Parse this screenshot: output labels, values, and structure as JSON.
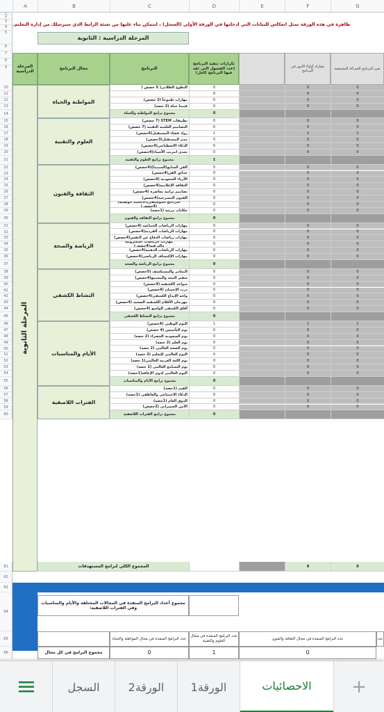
{
  "columns": [
    "A",
    "B",
    "C",
    "D",
    "E",
    "F",
    "G"
  ],
  "notice": "ظاهرة في هذه الورقة تمثل انعكاس للبيانات التي ادخلتها في الورقة الأولى (السجل) ، لتتمكن بناء عليها من تعبئة الرابط الذي سيرسلك من إدارة التعليم.",
  "stage_label": "المرحلة الدراسية : الثانوية",
  "headers": {
    "stage": "المرحلة الدراسية",
    "domain": "مجال البرنامج",
    "program": "البرنامج",
    "count": "تكرارات تنفيذ البرنامج (عدد الفصول التي نُفذ فيها البرنامج كامل)",
    "parents": "يشارك أولياء الأمور في البرنامج",
    "community": "يعزز البرنامج الشراكة المجتمعية"
  },
  "stage_vertical": "المرحلة الثانوية",
  "sections": [
    {
      "name": "المواطنة والحياة",
      "rows": [
        {
          "p": "التطوع الطلابي( 5 حصص )",
          "v": "0"
        },
        {
          "p": "",
          "v": "0"
        },
        {
          "p": "مهارات طموحاً (2 حصص)",
          "v": "0"
        },
        {
          "p": "قيمنا حياة (2 حصة)",
          "v": "0"
        }
      ],
      "total": "مجموع برامج المواطنة والحياة",
      "tv": "0"
    },
    {
      "name": "العلوم والتقنية",
      "rows": [
        {
          "p": "تطبيقات STEM (7 حصص)",
          "v": "0"
        },
        {
          "p": "التصاميم العلمية التقنية (7 حصص)",
          "v": "0"
        },
        {
          "p": "رواد فضاء المستقبل(6حصص)",
          "v": "1"
        },
        {
          "p": "مدن المستقبل(3حصص)",
          "v": "0"
        },
        {
          "p": "الذكاء الاصطناعي(4حصص)",
          "v": "0"
        },
        {
          "p": "تحدي انترنت الأشياء(4حصص)",
          "v": "0"
        }
      ],
      "total": "مجموع برامج العلوم والتقنية",
      "tv": "1"
    },
    {
      "name": "الثقافة والفنون",
      "rows": [
        {
          "p": "الفن السابع(السينما)(4حصص)",
          "v": "0"
        },
        {
          "p": "حدائق الفن(4حصص)",
          "v": "0"
        },
        {
          "p": "الأزياء السعودية (4حصص)",
          "v": "0"
        },
        {
          "p": "الثقافة الإعلامية(4حصص)",
          "v": "0"
        },
        {
          "p": "تصاميم تراثية معاصرة (4حصص)",
          "v": "0"
        },
        {
          "p": "الفنون المسرحية(4حصص)",
          "v": "0"
        },
        {
          "p": "البرنامج الموسيقي(الأناشيد الوطنية)(4حصص)",
          "v": "0"
        },
        {
          "p": "حكايات مرئية (1حصة)",
          "v": "0"
        }
      ],
      "total": "مجموع برامج الثقافة والفنون",
      "tv": "0"
    },
    {
      "name": "الرياضة والصحة",
      "rows": [
        {
          "p": "مهارات الرياضات الجماعية (4حصص)",
          "v": "0"
        },
        {
          "p": "مهارات الرياضات الفردية(4حصص)",
          "v": "0"
        },
        {
          "p": "مهارات رياضات الدفاع عن النفس(4حصص)",
          "v": "0"
        },
        {
          "p": "مهارات الرياضات الإلكترونية والترفيه(4حصص)",
          "v": "0"
        },
        {
          "p": "مهارات الرياضات الذهنية(4حصص)",
          "v": "0"
        },
        {
          "p": "مهارات الإكتشاف الرياضي(4حصص)",
          "v": "0"
        }
      ],
      "total": "مجموع برامج الرياضة والصحة",
      "tv": "0"
    },
    {
      "name": "النشاط الكشفي",
      "rows": [
        {
          "p": "المغامر والمستكشف (5حصص)",
          "v": "0"
        },
        {
          "p": "سفير البيئة والمجتمع(4حصص)",
          "v": "0"
        },
        {
          "p": "سواعد الكشفية (4حصص)",
          "v": "0"
        },
        {
          "p": "درب الإحسان (4حصص)",
          "v": "0"
        },
        {
          "p": "واحة الإبداع الكشفي(4حصص)",
          "v": "0"
        },
        {
          "p": "مهرجان الأفلام الكشفية الصحية (4حصص)",
          "v": "0"
        },
        {
          "p": "آفاق الكشفي الواسع (4حصص)",
          "v": "0"
        }
      ],
      "total": "مجموع برامج النشاط الكشفي",
      "tv": "0"
    },
    {
      "name": "الأيام والمناسبات",
      "rows": [
        {
          "p": "اليوم الوطني (4حصص)",
          "v": "1"
        },
        {
          "p": "يوم التأسيس (4 حصص)",
          "v": "0"
        },
        {
          "p": "يوم السعودية الخضراء (2 حصة)",
          "v": "0"
        },
        {
          "p": "يوم العلم (2 حصة)",
          "v": "0"
        },
        {
          "p": "يوم الصحة العالمي (2 حصة)",
          "v": "0"
        },
        {
          "p": "اليوم العالمي للتعليم (2 حصة)",
          "v": "0"
        },
        {
          "p": "يوم اللغة العربية العالمي(1 حصة)",
          "v": "0"
        },
        {
          "p": "يوم التسامح العالمي (1 حصة)",
          "v": "0"
        },
        {
          "p": "اليوم العالمي لذوي الإعاقة(1حصة)",
          "v": "0"
        }
      ],
      "total": "مجموع برامج الأيام والمناسبات",
      "tv": "0"
    },
    {
      "name": "الفترات اللاصفية",
      "rows": [
        {
          "p": "القيم (1حصة)",
          "v": "0"
        },
        {
          "p": "الذكاء الاجتماعي والعاطفي (1حصة)",
          "v": "0"
        },
        {
          "p": "الذوق العام (1حصة)",
          "v": "0"
        },
        {
          "p": "الأمن السيبراني (2حصص)",
          "v": "0"
        }
      ],
      "total": "مجموع برامج الفترات اللاصفية",
      "tv": "0"
    }
  ],
  "grand_total": "المجموع الكلي لبرامج المستهدفات",
  "grand_total_value": "0",
  "summary_title": "مجموع أعداد البرامج المنفذة في المجالات المختلفة والأيام والمناسبات وفي الفترات اللاصفية:",
  "summary_headers": [
    "عدد البرامج المنفذة في مجال المواطنة والحياة",
    "عدد البرامج المنفذة في مجال العلوم والتقنية",
    "عدد البرامج المنفذة في مجال الثقافة والفنون",
    "عدد"
  ],
  "summary_row_label": "مجموع البرامج في كل مجال",
  "summary_values": [
    "0",
    "1",
    "0"
  ],
  "row_numbers_top": [
    "1",
    "2",
    "3",
    "4",
    "5",
    "6",
    "7",
    "8",
    "9"
  ],
  "tabs": {
    "add": "+",
    "stats": "الاحصائيات",
    "sheet1": "الورقة1",
    "sheet2": "الورقة2",
    "log": "السجل",
    "menu": "menu"
  }
}
